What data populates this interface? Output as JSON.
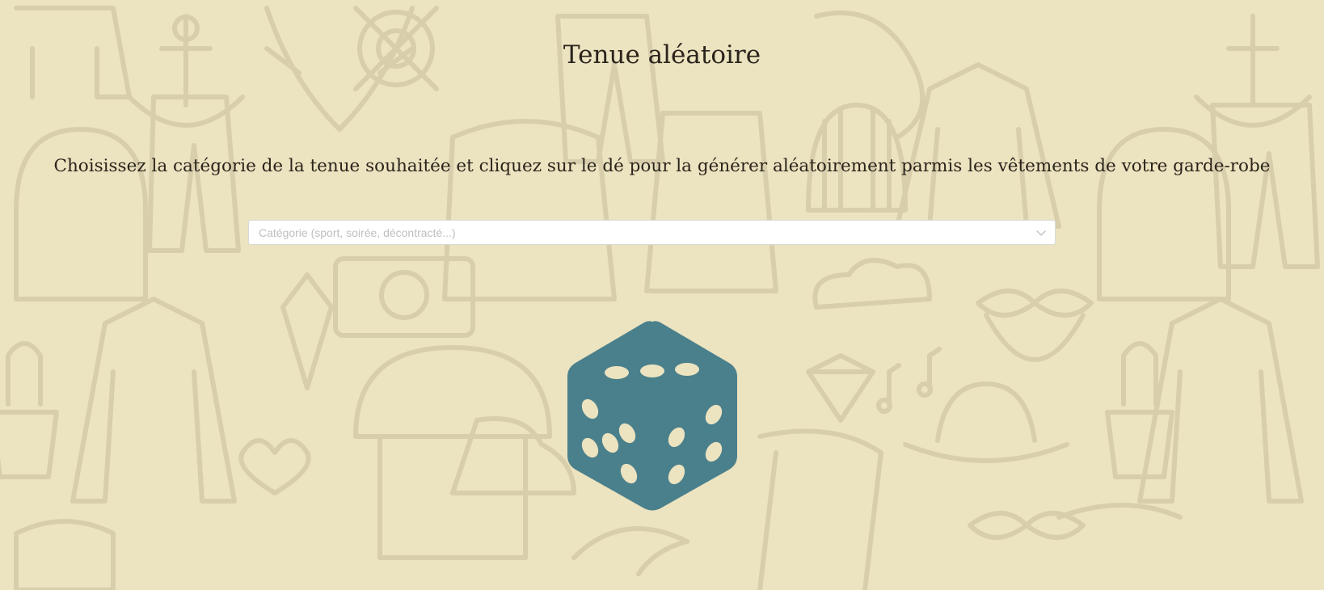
{
  "header": {
    "title": "Tenue aléatoire"
  },
  "main": {
    "instructions": "Choisissez la catégorie de la tenue souhaitée et cliquez sur le dé pour la générer aléatoirement parmis les vêtements de votre garde-robe",
    "category_select": {
      "placeholder": "Catégorie (sport, soirée, décontracté...)",
      "value": ""
    },
    "dice": {
      "icon": "dice-icon"
    }
  },
  "colors": {
    "background": "#ece3c0",
    "doodle": "#d8ceac",
    "dice": "#4a808c",
    "dice_pips": "#ece3c0",
    "text": "#2a241c"
  }
}
